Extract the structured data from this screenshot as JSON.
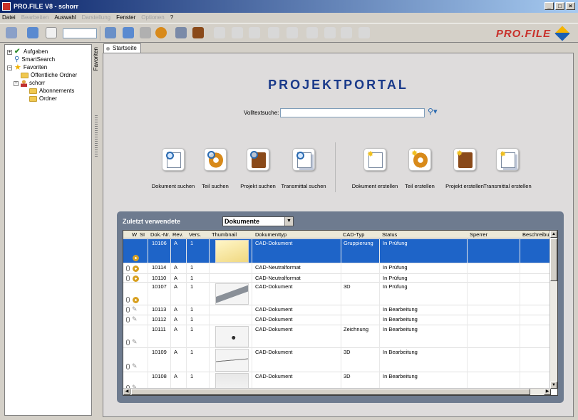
{
  "window": {
    "title": "PRO.FILE V8 - schorr",
    "minimize": "_",
    "maximize": "□",
    "close": "×"
  },
  "menu": [
    {
      "label": "Datei",
      "enabled": true
    },
    {
      "label": "Bearbeiten",
      "enabled": false
    },
    {
      "label": "Auswahl",
      "enabled": true
    },
    {
      "label": "Darstellung",
      "enabled": false
    },
    {
      "label": "Fenster",
      "enabled": true
    },
    {
      "label": "Optionen",
      "enabled": false
    },
    {
      "label": "?",
      "enabled": true
    }
  ],
  "brand": {
    "logo_text": "PRO.FILE"
  },
  "sidebar": {
    "tab_label": "Favoriten",
    "items": [
      {
        "label": "Aufgaben",
        "icon": "check-icon",
        "expander": "+"
      },
      {
        "label": "SmartSearch",
        "icon": "search-icon",
        "expander": ""
      },
      {
        "label": "Favoriten",
        "icon": "star-icon",
        "expander": "−"
      },
      {
        "label": "Öffentliche Ordner",
        "icon": "folder-icon",
        "expander": ""
      },
      {
        "label": "schorr",
        "icon": "user-icon",
        "expander": "−"
      },
      {
        "label": "Abonnements",
        "icon": "folder-icon",
        "expander": ""
      },
      {
        "label": "Ordner",
        "icon": "folder-icon",
        "expander": ""
      }
    ]
  },
  "tabs": {
    "start": "Startseite"
  },
  "portal": {
    "title": "PROJEKTPORTAL",
    "search_label": "Volltextsuche:",
    "search_value": "",
    "actions": [
      {
        "label": "Dokument suchen",
        "icon": "doc"
      },
      {
        "label": "Teil suchen",
        "icon": "gear"
      },
      {
        "label": "Projekt suchen",
        "icon": "box"
      },
      {
        "label": "Transmittal suchen",
        "icon": "trans"
      },
      {
        "label": "Dokument erstellen",
        "icon": "doc"
      },
      {
        "label": "Teil erstellen",
        "icon": "gear"
      },
      {
        "label": "Projekt erstellen",
        "icon": "box"
      },
      {
        "label": "Transmittal erstellen",
        "icon": "trans"
      }
    ]
  },
  "recent": {
    "title": "Zuletzt verwendete",
    "filter_value": "Dokumente",
    "columns": [
      "W",
      "SI",
      "Dok.-Nr.",
      "Rev.",
      "Vers.",
      "Thumbnail",
      "Dokumenttyp",
      "CAD-Typ",
      "Status",
      "Sperrer",
      "Beschreibu"
    ],
    "rows": [
      {
        "nr": "10106",
        "rev": "A",
        "vers": "1",
        "typ": "CAD-Dokument",
        "cad": "Gruppierung",
        "status": "In Prüfung",
        "selected": true
      },
      {
        "nr": "10114",
        "rev": "A",
        "vers": "1",
        "typ": "CAD-Neutralformat",
        "cad": "",
        "status": "In Prüfung",
        "selected": false
      },
      {
        "nr": "10110",
        "rev": "A",
        "vers": "1",
        "typ": "CAD-Neutralformat",
        "cad": "",
        "status": "In Prüfung",
        "selected": false
      },
      {
        "nr": "10107",
        "rev": "A",
        "vers": "1",
        "typ": "CAD-Dokument",
        "cad": "3D",
        "status": "In Prüfung",
        "selected": false
      },
      {
        "nr": "10113",
        "rev": "A",
        "vers": "1",
        "typ": "CAD-Dokument",
        "cad": "",
        "status": "In Bearbeitung",
        "selected": false
      },
      {
        "nr": "10112",
        "rev": "A",
        "vers": "1",
        "typ": "CAD-Dokument",
        "cad": "",
        "status": "In Bearbeitung",
        "selected": false
      },
      {
        "nr": "10111",
        "rev": "A",
        "vers": "1",
        "typ": "CAD-Dokument",
        "cad": "Zeichnung",
        "status": "In Bearbeitung",
        "selected": false
      },
      {
        "nr": "10109",
        "rev": "A",
        "vers": "1",
        "typ": "CAD-Dokument",
        "cad": "3D",
        "status": "In Bearbeitung",
        "selected": false
      },
      {
        "nr": "10108",
        "rev": "A",
        "vers": "1",
        "typ": "CAD-Dokument",
        "cad": "3D",
        "status": "In Bearbeitung",
        "selected": false
      }
    ]
  },
  "colors": {
    "title_bar": "#0a246a",
    "selection": "#1e64c8",
    "portal_title": "#1a3a8a",
    "recent_panel": "#6e7b8f",
    "brand": "#c8302a"
  }
}
